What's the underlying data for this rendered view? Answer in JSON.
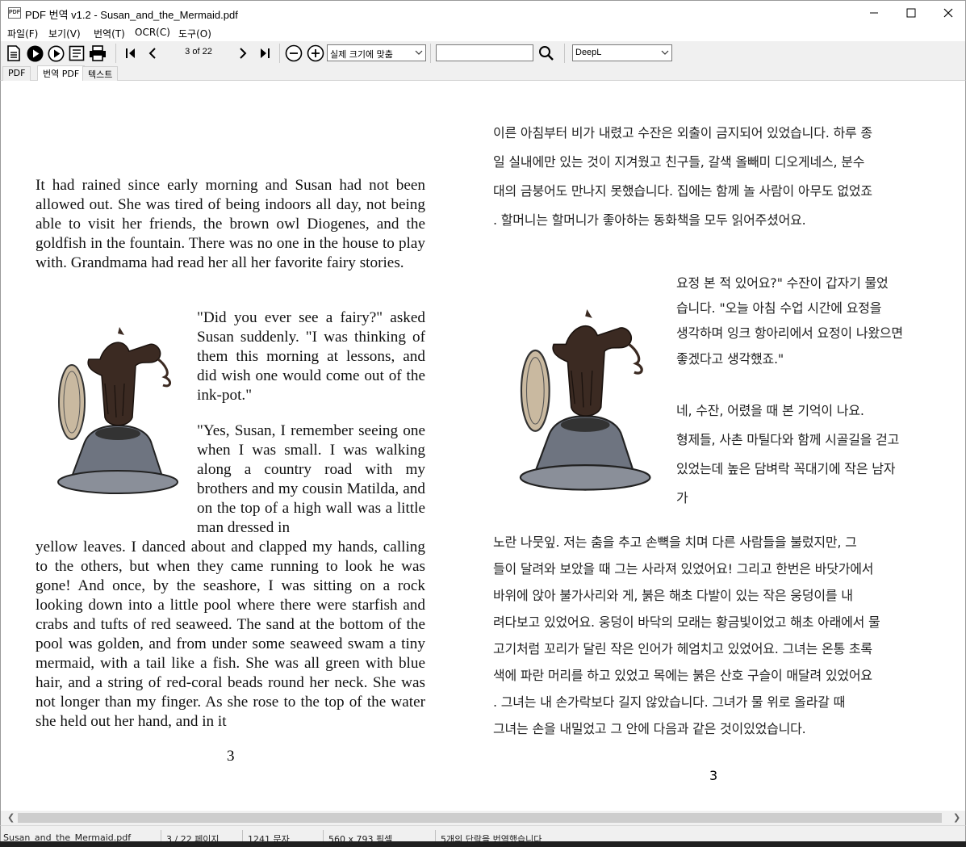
{
  "window": {
    "app_icon_text": "PDF",
    "title": "PDF 번역 v1.2 - Susan_and_the_Mermaid.pdf"
  },
  "menu": {
    "file": "파일(F)",
    "view": "보기(V)",
    "translate": "번역(T)",
    "ocr": "OCR(C)",
    "tools": "도구(O)"
  },
  "toolbar": {
    "page_indicator": "3 of 22",
    "zoom_selected": "실제 크기에 맞춤",
    "search_value": "",
    "engine_selected": "DeepL"
  },
  "tabs": {
    "pdf": "PDF",
    "translated_pdf": "번역 PDF",
    "text": "텍스트"
  },
  "english_page": {
    "para1": "It had rained since early morning and Susan had not been allowed out. She was tired of being indoors all day, not being able to visit her friends, the brown owl Diogenes, and the goldfish in the fountain. There was no one in the house to play with. Grandmama had read her all her favorite fairy stories.",
    "para2": "\"Did you ever see a fairy?\" asked Susan suddenly. \"I was thinking of them this morning at lessons, and did wish one would come out of the ink-pot.\"",
    "para3": "\"Yes, Susan, I remember seeing one when I was small. I was walking along a country road with my brothers and my cousin Matilda, and on the top of a high wall was a little man dressed in",
    "para4": "yellow leaves. I danced about and clapped my hands, calling to the others, but when they came running to look he was gone! And once, by the seashore, I was sitting on a rock looking down into a little pool where there were starfish and crabs and tufts of red seaweed. The sand at the bottom of the pool was golden, and from under some seaweed swam a tiny mermaid, with a tail like a fish. She was all green with blue hair, and a string of red-coral beads round her neck. She was not longer than my finger. As she rose to the top of the water she held out her hand, and in it",
    "page_number": "3"
  },
  "korean_page": {
    "lines_top": [
      "이른 아침부터 비가 내렸고 수잔은 외출이 금지되어 있었습니다. 하루 종",
      "일 실내에만 있는 것이 지겨웠고 친구들, 갈색 올빼미 디오게네스, 분수",
      "대의 금붕어도 만나지 못했습니다. 집에는 함께 놀 사람이 아무도 없었죠",
      ". 할머니는 할머니가 좋아하는 동화책을 모두 읽어주셨어요."
    ],
    "lines_side": [
      "요정 본 적 있어요?\" 수잔이 갑자기 물었",
      "습니다. \"오늘 아침 수업 시간에 요정을",
      "생각하며 잉크 항아리에서 요정이 나왔으면",
      "좋겠다고 생각했죠.\"",
      "네, 수잔, 어렸을 때 본 기억이 나요.",
      "형제들, 사촌 마틸다와 함께 시골길을 걷고",
      "있었는데 높은 담벼락 꼭대기에 작은 남자",
      "가"
    ],
    "lines_bottom": [
      "노란 나뭇잎. 저는 춤을 추고 손뼉을 치며 다른 사람들을 불렀지만, 그",
      "들이 달려와 보았을 때 그는 사라져 있었어요! 그리고 한번은 바닷가에서",
      "바위에 앉아 불가사리와 게, 붉은 해초 다발이 있는 작은 웅덩이를 내",
      "려다보고 있었어요. 웅덩이 바닥의 모래는 황금빛이었고 해초 아래에서 물",
      "고기처럼 꼬리가 달린 작은 인어가 헤엄치고 있었어요. 그녀는 온통 초록",
      "색에 파란 머리를 하고 있었고 목에는 붉은 산호 구슬이 매달려 있었어요",
      ". 그녀는 내 손가락보다 길지 않았습니다. 그녀가 물 위로 올라갈 때",
      "그녀는 손을 내밀었고 그 안에 다음과 같은 것이있었습니다."
    ],
    "page_number": "3"
  },
  "status": {
    "filename": "Susan_and_the_Mermaid.pdf",
    "pages": "3 / 22 페이지",
    "chars": "1241 문자",
    "size": "560 x 793 픽셀",
    "message": "5개의 단락을 번역했습니다"
  }
}
